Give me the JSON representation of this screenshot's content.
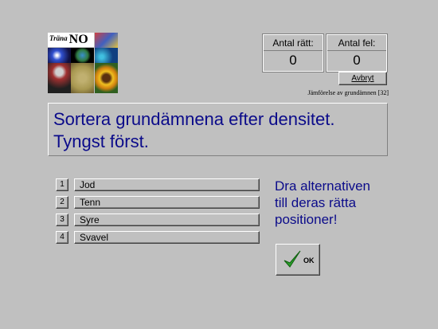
{
  "logo": {
    "text_small": "Träna",
    "text_big": "NO"
  },
  "score": {
    "correct_label": "Antal rätt:",
    "correct_value": "0",
    "wrong_label": "Antal fel:",
    "wrong_value": "0"
  },
  "cancel_button": {
    "label": "Avbryt"
  },
  "subtitle": "Jämförelse av grundämnen [32]",
  "question": {
    "line1": "Sortera grundämnena efter densitet.",
    "line2": "Tyngst först."
  },
  "items": [
    {
      "num": "1",
      "label": "Jod"
    },
    {
      "num": "2",
      "label": "Tenn"
    },
    {
      "num": "3",
      "label": "Syre"
    },
    {
      "num": "4",
      "label": "Svavel"
    }
  ],
  "instruction": {
    "line1": "Dra alternativen",
    "line2": "till deras rätta",
    "line3": "positioner!"
  },
  "ok_button": {
    "label": "OK",
    "icon": "checkmark-icon"
  },
  "colors": {
    "background": "#c0c0c0",
    "text_blue": "#0b0b8a",
    "check_green": "#2aa02a"
  }
}
